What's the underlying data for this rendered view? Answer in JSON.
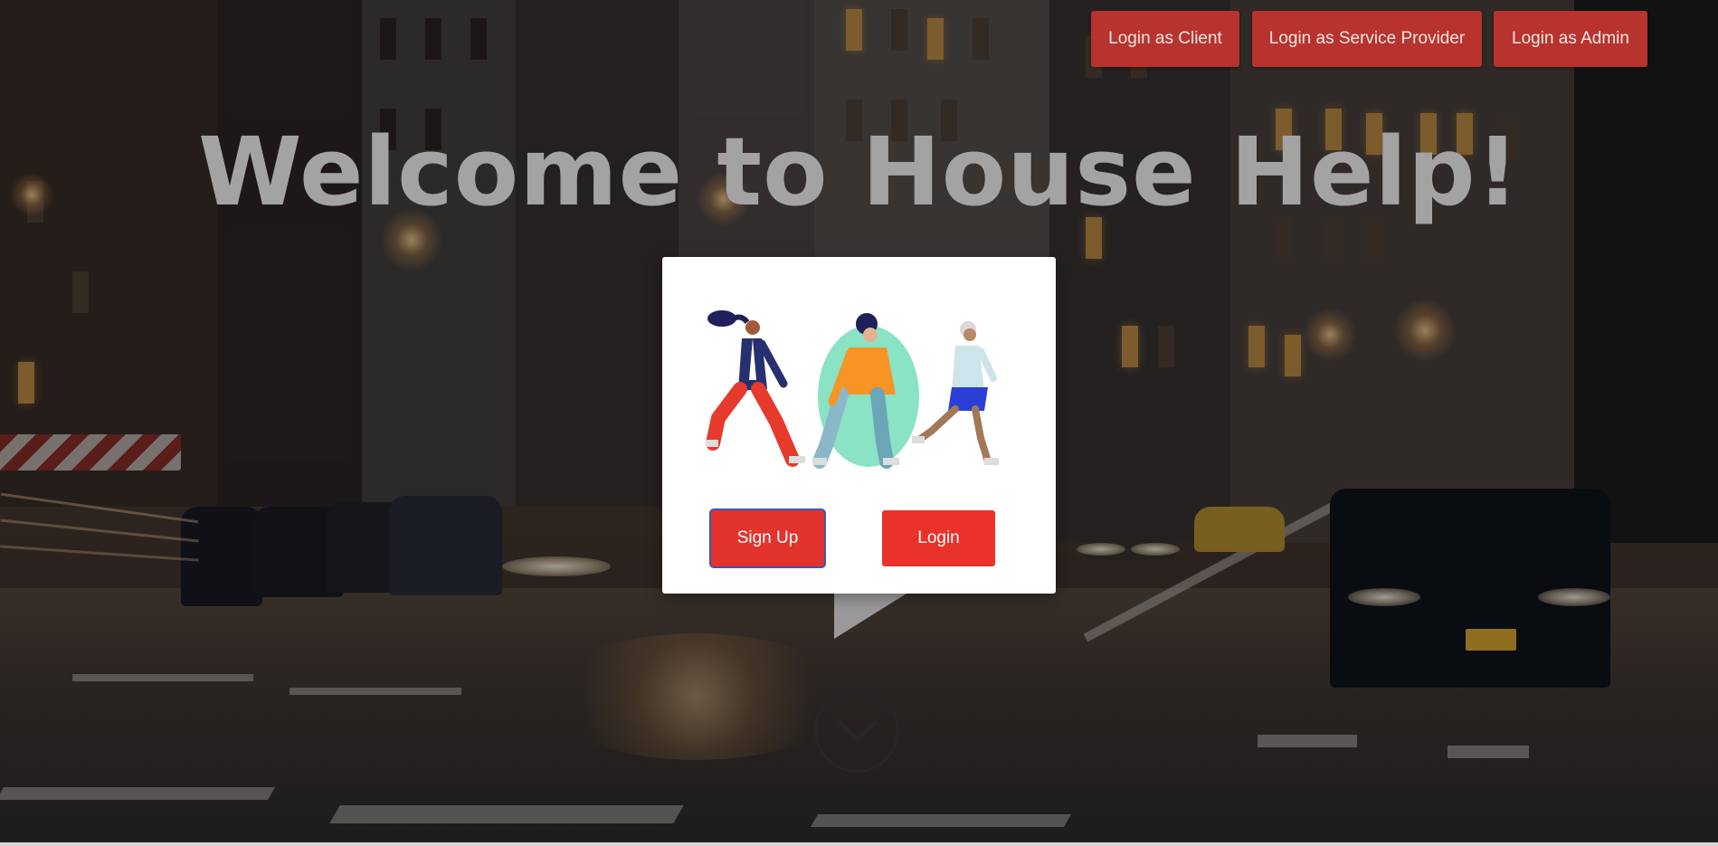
{
  "nav": {
    "login_client": "Login as Client",
    "login_provider": "Login as Service Provider",
    "login_admin": "Login as Admin"
  },
  "hero": {
    "title": "Welcome to House Help!"
  },
  "card": {
    "signup_label": "Sign Up",
    "login_label": "Login"
  },
  "colors": {
    "nav_button": "#b8332d",
    "card_button": "#e8322a",
    "signup_focus_ring": "#3f56b0",
    "title": "#a3a3a3"
  },
  "icons": {
    "scroll": "chevron-down-icon"
  }
}
